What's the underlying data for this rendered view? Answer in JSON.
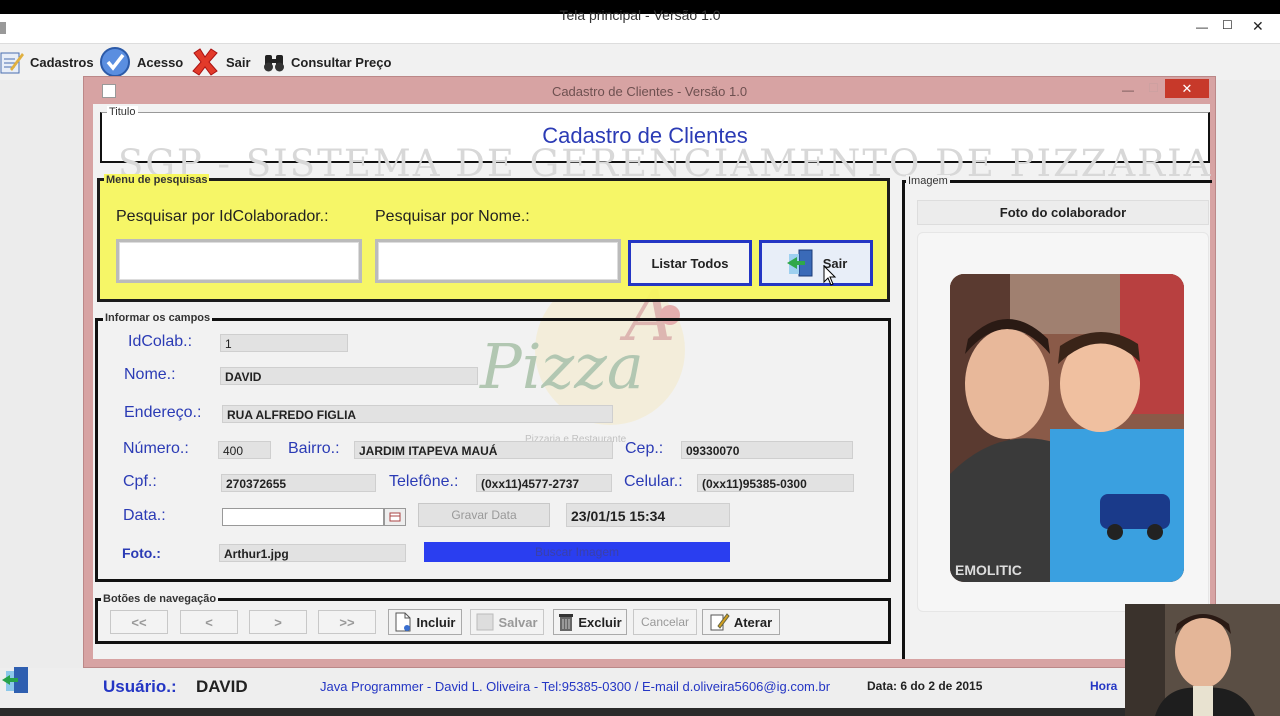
{
  "main_window": {
    "title": "Tela principal  - Versão 1.0",
    "controls": {
      "minimize": "—",
      "maximize": "☐",
      "close": "✕"
    }
  },
  "menubar": {
    "items": [
      {
        "label": "Cadastros",
        "icon": "pencil-form-icon"
      },
      {
        "label": "Acesso",
        "icon": "check-icon"
      },
      {
        "label": "Sair",
        "icon": "red-x-icon"
      },
      {
        "label": "Consultar Preço",
        "icon": "binoculars-icon"
      }
    ]
  },
  "child_window": {
    "title": "Cadastro de Clientes - Versão 1.0",
    "controls": {
      "minimize": "—",
      "maximize": "☐",
      "close": "✕"
    }
  },
  "titulo_panel": {
    "legend": "Titulo",
    "heading": "Cadastro de Clientes",
    "watermark": "SGP - SISTEMA DE GERENCIAMENTO DE PIZZARIA"
  },
  "search_panel": {
    "legend": "Menu de pesquisas",
    "by_id_label": "Pesquisar por IdColaborador.:",
    "by_name_label": "Pesquisar por Nome.:",
    "by_id_value": "",
    "by_name_value": "",
    "list_all_label": "Listar Todos",
    "exit_label": "Sair"
  },
  "fields_panel": {
    "legend": "Informar os campos",
    "id_label": "IdColab.:",
    "id_value": "1",
    "name_label": "Nome.:",
    "name_value": "DAVID",
    "address_label": "Endereço.:",
    "address_value": "RUA ALFREDO FIGLIA",
    "number_label": "Número.:",
    "number_value": "400",
    "district_label": "Bairro.:",
    "district_value": "JARDIM ITAPEVA MAUÁ",
    "cep_label": "Cep.:",
    "cep_value": "09330070",
    "cpf_label": "Cpf.:",
    "cpf_value": "270372655",
    "phone_label": "Telefône.:",
    "phone_value": "(0xx11)4577-2737",
    "mobile_label": "Celular.:",
    "mobile_value": "(0xx11)95385-0300",
    "date_label": "Data.:",
    "date_value": "",
    "save_date_label": "Gravar Data",
    "timestamp_value": "23/01/15 15:34",
    "photo_label": "Foto.:",
    "photo_value": "Arthur1.jpg",
    "select_image_label": "Buscar Imagem"
  },
  "logo": {
    "text": "Pizza",
    "sub": "Pizzaria e Restaurante"
  },
  "image_panel": {
    "legend": "Imagem",
    "photo_header": "Foto do colaborador",
    "shirt_text": "EMOLITIC"
  },
  "nav_panel": {
    "legend": "Botões de navegação",
    "first": "<<",
    "prev": "<",
    "next": ">",
    "last": ">>",
    "include": "Incluir",
    "save": "Salvar",
    "delete": "Excluir",
    "cancel": "Cancelar",
    "edit": "Aterar"
  },
  "status_bar": {
    "user_label": "Usuário.:",
    "user_value": "DAVID",
    "credits": "Java Programmer - David L. Oliveira - Tel:95385-0300 / E-mail d.oliveira5606@ig.com.br",
    "date_text": "Data: 6 do 2 de 2015",
    "hour_label": "Hora"
  },
  "colors": {
    "accent_blue": "#2436c4",
    "search_panel_bg": "#f7f760",
    "child_frame": "#d7a3a3",
    "label_blue": "#2b3bb5"
  }
}
